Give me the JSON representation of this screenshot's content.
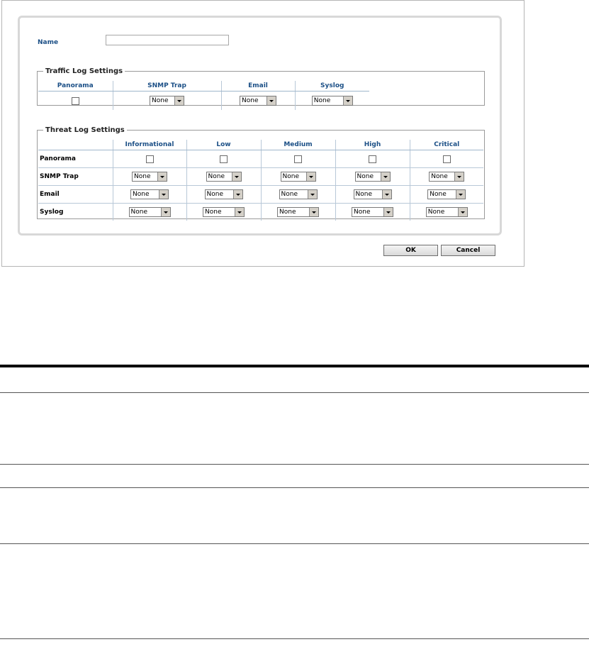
{
  "form": {
    "name_label": "Name",
    "name_value": "",
    "ok_label": "OK",
    "cancel_label": "Cancel"
  },
  "traffic": {
    "legend": "Traffic Log Settings",
    "headers": [
      "Panorama",
      "SNMP Trap",
      "Email",
      "Syslog"
    ],
    "selects": [
      "None",
      "None",
      "None"
    ]
  },
  "threat": {
    "legend": "Threat Log Settings",
    "headers": [
      "Informational",
      "Low",
      "Medium",
      "High",
      "Critical"
    ],
    "rows": [
      {
        "label": "Panorama",
        "kind": "checkbox"
      },
      {
        "label": "SNMP Trap",
        "kind": "select",
        "values": [
          "None",
          "None",
          "None",
          "None",
          "None"
        ]
      },
      {
        "label": "Email",
        "kind": "select",
        "values": [
          "None",
          "None",
          "None",
          "None",
          "None"
        ]
      },
      {
        "label": "Syslog",
        "kind": "select",
        "values": [
          "None",
          "None",
          "None",
          "None",
          "None"
        ]
      }
    ]
  },
  "colors": {
    "header_text": "#1b4f86",
    "panel_border": "#d8d8d8"
  }
}
